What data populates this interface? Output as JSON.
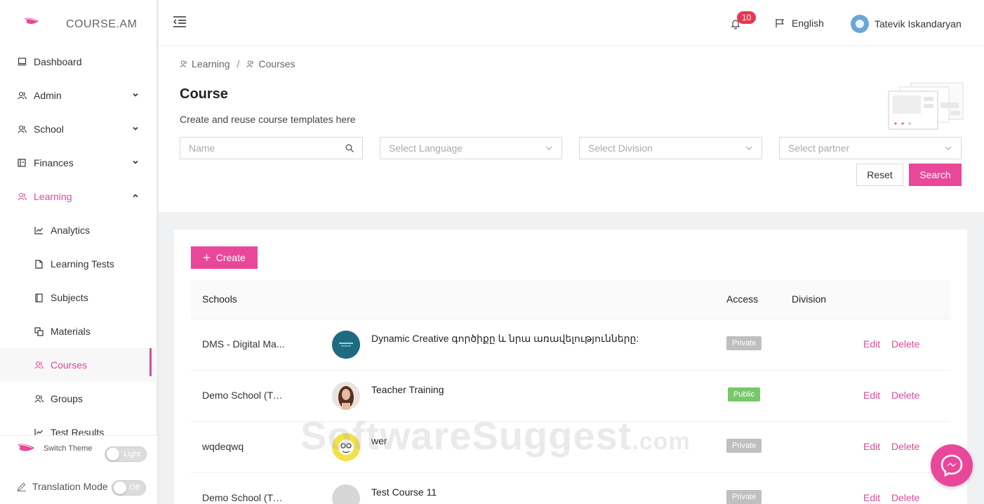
{
  "app": {
    "logo_text": "COURSE.AM"
  },
  "sidebar": {
    "items": [
      {
        "label": "Dashboard",
        "icon": "laptop-icon"
      },
      {
        "label": "Admin",
        "icon": "user-group-icon"
      },
      {
        "label": "School",
        "icon": "user-group-icon"
      },
      {
        "label": "Finances",
        "icon": "ledger-icon"
      },
      {
        "label": "Learning",
        "icon": "user-group-icon"
      },
      {
        "label": "Analytics",
        "icon": "line-chart-icon"
      },
      {
        "label": "Learning Tests",
        "icon": "file-icon"
      },
      {
        "label": "Subjects",
        "icon": "book-icon"
      },
      {
        "label": "Materials",
        "icon": "copy-icon"
      },
      {
        "label": "Courses",
        "icon": "user-group-icon"
      },
      {
        "label": "Groups",
        "icon": "user-group-icon"
      },
      {
        "label": "Test Results",
        "icon": "line-chart-icon"
      }
    ],
    "switch_theme_label": "Switch Theme",
    "theme_toggle_value": "Light",
    "translation_mode_label": "Translation Mode",
    "translation_toggle_value": "Off"
  },
  "header": {
    "notification_count": "10",
    "language": "English",
    "user_name": "Tatevik Iskandaryan"
  },
  "breadcrumb": {
    "items": [
      "Learning",
      "Courses"
    ],
    "separator": "/"
  },
  "page": {
    "title": "Course",
    "subtitle": "Create and reuse course templates here"
  },
  "filters": {
    "name_placeholder": "Name",
    "language_placeholder": "Select Language",
    "division_placeholder": "Select Division",
    "partner_placeholder": "Select partner",
    "reset_label": "Reset",
    "search_label": "Search"
  },
  "table": {
    "create_label": "Create",
    "columns": {
      "schools": "Schools",
      "access": "Access",
      "division": "Division"
    },
    "rows": [
      {
        "school": "DMS - Digital Ma...",
        "course": "Dynamic Creative գործիքը և նրա առավելությունները:",
        "access": "Private",
        "edit": "Edit",
        "delete": "Delete"
      },
      {
        "school": "Demo School (Tu...",
        "course": "Teacher Training",
        "access": "Public",
        "edit": "Edit",
        "delete": "Delete"
      },
      {
        "school": "wqdeqwq",
        "course": "wer",
        "access": "Private",
        "edit": "Edit",
        "delete": "Delete"
      },
      {
        "school": "Demo School (Tu...",
        "course": "Test Course 11",
        "access": "Private",
        "edit": "Edit",
        "delete": "Delete"
      }
    ]
  },
  "watermark": {
    "main": "SoftwareSuggest",
    "suffix": ".com"
  },
  "colors": {
    "accent": "#e9479a",
    "private_badge": "#bfbfbf",
    "public_badge": "#78c86a",
    "notification_badge": "#e53950"
  }
}
